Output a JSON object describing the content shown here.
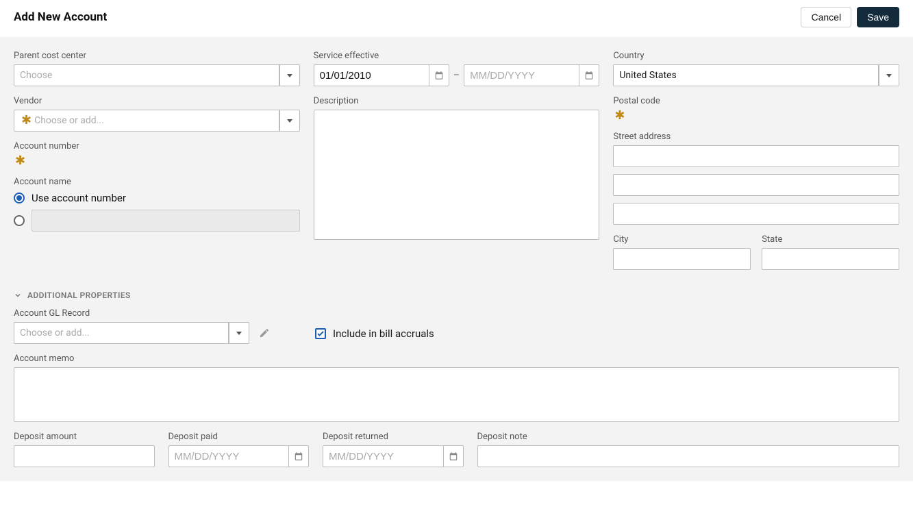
{
  "header": {
    "title": "Add New Account",
    "cancel_label": "Cancel",
    "save_label": "Save"
  },
  "col1": {
    "parent_cost_center_label": "Parent cost center",
    "parent_cost_center_placeholder": "Choose",
    "vendor_label": "Vendor",
    "vendor_placeholder": "Choose or add...",
    "account_number_label": "Account number",
    "account_name_label": "Account name",
    "use_account_number_label": "Use account number"
  },
  "col2": {
    "service_effective_label": "Service effective",
    "service_start_value": "01/01/2010",
    "service_end_placeholder": "MM/DD/YYYY",
    "description_label": "Description"
  },
  "col3": {
    "country_label": "Country",
    "country_value": "United States",
    "postal_code_label": "Postal code",
    "street_address_label": "Street address",
    "city_label": "City",
    "state_label": "State"
  },
  "additional": {
    "section_title": "ADDITIONAL PROPERTIES",
    "gl_record_label": "Account GL Record",
    "gl_record_placeholder": "Choose or add...",
    "include_accruals_label": "Include in bill accruals",
    "account_memo_label": "Account memo",
    "deposit_amount_label": "Deposit amount",
    "deposit_paid_label": "Deposit paid",
    "deposit_paid_placeholder": "MM/DD/YYYY",
    "deposit_returned_label": "Deposit returned",
    "deposit_returned_placeholder": "MM/DD/YYYY",
    "deposit_note_label": "Deposit note"
  }
}
